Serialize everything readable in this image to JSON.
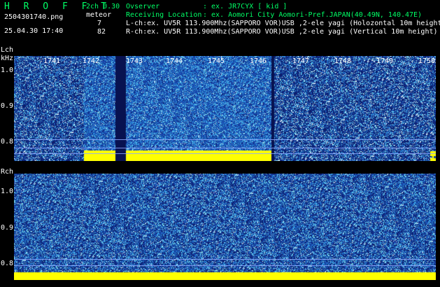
{
  "header": {
    "title": "H R O F F T",
    "filename": "2504301740.png",
    "datetime": "25.04.30 17:40",
    "channels_label": "2ch 0.30",
    "meteor_label": "meteor",
    "lch_count": "7",
    "rch_count": "82",
    "observer_label": "Ovserver",
    "observer_value": ": ex. JR7CYX [ kid ]",
    "location_label": "Receiving Location",
    "location_value": ": ex. Aomori City Aomori-Pref.JAPAN(40.49N, 140.47E)",
    "lch_info": "L-ch:ex. UV5R 113.900Mhz(SAPPORO VOR)USB ,2-ele yagi (Holozontal 10m height",
    "rch_info": "R-ch:ex. UV5R 113.900Mhz(SAPPORO VOR)USB ,2-ele yagi (Vertical 10m height)"
  },
  "lch": {
    "label": "Lch",
    "unit": "kHz",
    "y_ticks": [
      "1.0",
      "0.9",
      "0.8"
    ]
  },
  "rch": {
    "label": "Rch",
    "y_ticks": [
      "1.0",
      "0.9",
      "0.8"
    ]
  },
  "time_ticks": [
    "1741",
    "1742",
    "1743",
    "1744",
    "1745",
    "1746",
    "1747",
    "1748",
    "1749",
    "1750"
  ],
  "colors": {
    "background": "#000000",
    "header_green": "#00ff66",
    "spectrum_base": "#0a1f78",
    "signal_yellow": "#ffff00"
  }
}
